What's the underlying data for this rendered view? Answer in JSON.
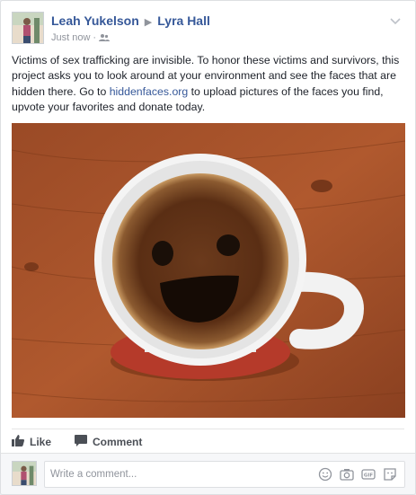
{
  "post": {
    "author": "Leah Yukelson",
    "target": "Lyra Hall",
    "timestamp": "Just now",
    "audience_icon": "friends-icon",
    "text_before_link": "Victims of sex trafficking are invisible. To honor these victims and survivors, this project asks you to look around at your environment and see the faces that are hidden there. Go to ",
    "link": "hiddenfaces.org",
    "text_after_link": " to upload pictures of the faces you find, upvote your favorites and donate today."
  },
  "actions": {
    "like_label": "Like",
    "comment_label": "Comment"
  },
  "composer": {
    "placeholder": "Write a comment...",
    "icons": [
      "emoji-icon",
      "camera-icon",
      "gif-icon",
      "sticker-icon"
    ]
  },
  "colors": {
    "link": "#365899",
    "meta": "#90949c",
    "action_text": "#4b4f56"
  }
}
